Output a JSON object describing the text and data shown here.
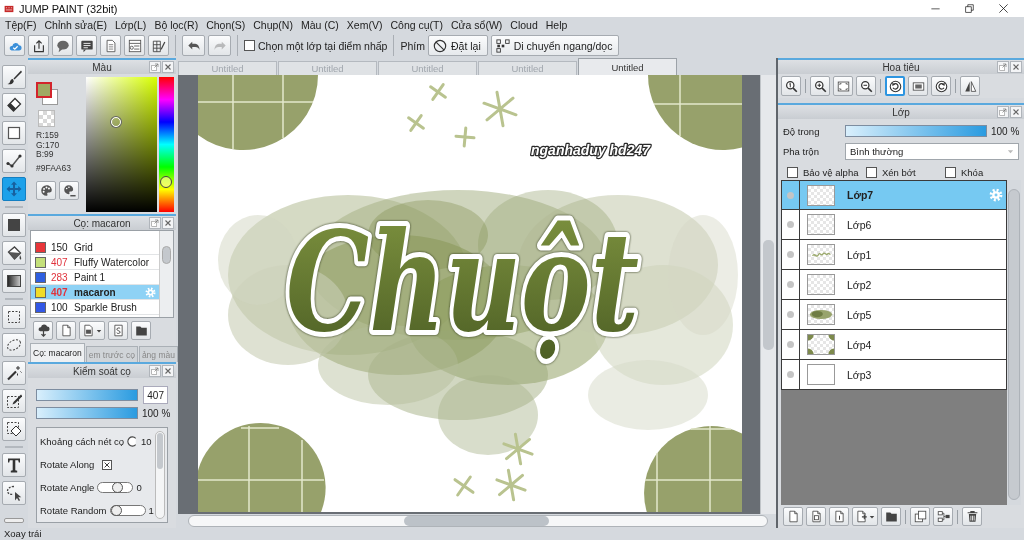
{
  "window": {
    "title": "JUMP PAINT (32bit)"
  },
  "menu": [
    "Tệp(F)",
    "Chỉnh sửa(E)",
    "Lớp(L)",
    "Bộ lọc(R)",
    "Chọn(S)",
    "Chụp(N)",
    "Màu (C)",
    "Xem(V)",
    "Công cụ(T)",
    "Cửa sổ(W)",
    "Cloud",
    "Help"
  ],
  "toolbar": {
    "history_buttons": [
      {
        "disabled": false
      },
      {
        "disabled": true
      }
    ],
    "pick_layer": {
      "label": "Chọn một lớp tại điểm nhấp",
      "checked": false
    },
    "keys_label": "Phím",
    "reset_button": "Đặt lại",
    "move_button": "Di chuyển ngang/dọc"
  },
  "tools": [
    [
      {
        "selected": false
      },
      {
        "selected": false
      },
      {
        "selected": false
      },
      {
        "selected": false
      },
      {
        "selected": true
      }
    ],
    [
      {
        "selected": false
      },
      {
        "selected": false
      },
      {
        "selected": false
      }
    ],
    [
      {
        "selected": false
      },
      {
        "selected": false
      },
      {
        "selected": false
      },
      {
        "selected": false
      },
      {
        "selected": false
      }
    ],
    [
      {
        "selected": false
      },
      {
        "selected": false
      }
    ]
  ],
  "color_panel": {
    "title": "Màu",
    "color": "#9faa63",
    "channels": [
      "R:159",
      "G:170",
      "B:99"
    ],
    "hex": "#9FAA63"
  },
  "brush_panel": {
    "title": "Cọ: macaron",
    "brushes": [
      {
        "size": "150",
        "name": "Grid",
        "color": "#e8363a",
        "size_highlighted": false,
        "selected": false
      },
      {
        "size": "407",
        "name": "Fluffy Watercolor",
        "color": "#c4e07a",
        "size_highlighted": true,
        "selected": false
      },
      {
        "size": "283",
        "name": "Paint 1",
        "color": "#2f5fe0",
        "size_highlighted": true,
        "selected": false
      },
      {
        "size": "407",
        "name": "macaron",
        "color": "#f0dc28",
        "size_highlighted": true,
        "selected": true
      },
      {
        "size": "100",
        "name": "Sparkle Brush",
        "color": "#3358e6",
        "size_highlighted": false,
        "selected": false
      }
    ],
    "tabs": [
      {
        "label": "Cọ: macaron",
        "selected": true
      },
      {
        "label": "em trước cọ",
        "selected": false
      },
      {
        "label": "ảng màu",
        "selected": false
      }
    ]
  },
  "brush_control": {
    "title": "Kiểm soát cọ",
    "size": {
      "level": 1,
      "value": "407"
    },
    "opacity": {
      "level": 1,
      "reading": "100 %"
    },
    "settings": [
      {
        "kind": "dial",
        "label": "Khoảng cách nét cọ",
        "value": "10"
      },
      {
        "kind": "checkbox",
        "label": "Rotate Along",
        "checked": true
      },
      {
        "kind": "slider",
        "label": "Rotate Angle",
        "level": 0.6,
        "value": "0"
      },
      {
        "kind": "slider",
        "label": "Rotate Random",
        "level": 0.05,
        "value": "1"
      }
    ]
  },
  "document_tabs": [
    {
      "label": "Untitled",
      "selected": false
    },
    {
      "label": "Untitled",
      "selected": false
    },
    {
      "label": "Untitled",
      "selected": false
    },
    {
      "label": "Untitled",
      "selected": false
    },
    {
      "label": "Untitled",
      "selected": true
    }
  ],
  "canvas": {
    "lettering": "Chuột",
    "signature": "nganhaduy hd247"
  },
  "navigator": {
    "title": "Hoa tiêu",
    "tools": [
      [
        {
          "selected": false
        }
      ],
      [
        {
          "selected": false
        },
        {
          "selected": false
        },
        {
          "selected": false
        }
      ],
      [
        {
          "selected": true
        },
        {
          "selected": false
        },
        {
          "selected": false
        }
      ],
      [
        {
          "selected": false
        }
      ]
    ]
  },
  "layers_panel": {
    "title": "Lớp",
    "opacity_label": "Độ trong",
    "opacity": {
      "level": 1,
      "reading": "100 %"
    },
    "blend_label": "Pha trộn",
    "blend_mode": "Bình thường",
    "options": [
      {
        "label": "Bảo vệ alpha",
        "checked": false
      },
      {
        "label": "Xén bớt",
        "checked": false
      },
      {
        "label": "Khóa",
        "checked": false
      }
    ],
    "layers": [
      {
        "name": "Lớp7",
        "selected": true
      },
      {
        "name": "Lớp6",
        "selected": false
      },
      {
        "name": "Lớp1",
        "selected": false
      },
      {
        "name": "Lớp2",
        "selected": false
      },
      {
        "name": "Lớp5",
        "selected": false
      },
      {
        "name": "Lớp4",
        "selected": false
      },
      {
        "name": "Lớp3",
        "selected": false
      }
    ]
  },
  "status_bar": "Xoay trái"
}
